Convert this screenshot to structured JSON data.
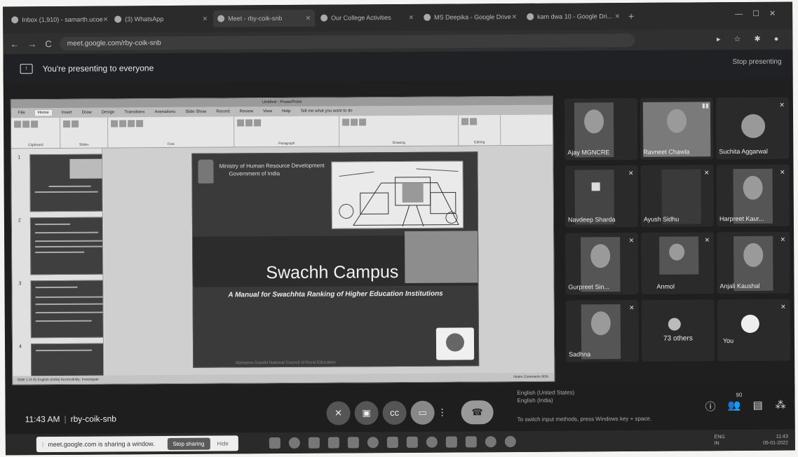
{
  "browser": {
    "tabs": [
      {
        "label": "Inbox (1,910) - samarth.ucoe",
        "active": false
      },
      {
        "label": "(3) WhatsApp",
        "active": false
      },
      {
        "label": "Meet - rby-coik-snb",
        "active": true
      },
      {
        "label": "Our College Activities",
        "active": false
      },
      {
        "label": "MS Deepika - Google Drive",
        "active": false
      },
      {
        "label": "kam dwa 10 - Google Dri...",
        "active": false
      }
    ],
    "url": "meet.google.com/rby-coik-snb"
  },
  "banner": {
    "text": "You're presenting to everyone",
    "stop_label": "Stop presenting"
  },
  "ppt": {
    "title": "Untitled - PowerPoint",
    "menu": [
      "File",
      "Home",
      "Insert",
      "Draw",
      "Design",
      "Transitions",
      "Animations",
      "Slide Show",
      "Record",
      "Review",
      "View",
      "Help",
      "Tell me what you want to do"
    ],
    "groups": [
      "Clipboard",
      "Slides",
      "Font",
      "Paragraph",
      "Drawing",
      "Editing"
    ],
    "thumb_numbers": [
      "1",
      "2",
      "3",
      "4"
    ],
    "status_left": "Slide 1 of 35   English (India)   Accessibility: Investigate",
    "status_right": "Notes   Comments        80%"
  },
  "slide": {
    "ministry": "Ministry of Human Resource Development",
    "government": "Government of India",
    "title": "Swachh Campus",
    "subtitle": "A Manual for Swachhta Ranking of Higher Education Institutions",
    "footer": "Mahatma Gandhi National Council of Rural Education"
  },
  "participants": [
    {
      "name": "Ajay MGNCRE",
      "type": "video"
    },
    {
      "name": "Ravneet Chawla",
      "type": "video"
    },
    {
      "name": "Suchita Aggarwal",
      "type": "avatar"
    },
    {
      "name": "Navdeep Sharda",
      "type": "video"
    },
    {
      "name": "Ayush Sidhu",
      "type": "video"
    },
    {
      "name": "Harpreet Kaur...",
      "type": "video"
    },
    {
      "name": "Gurpreet Sin...",
      "type": "video"
    },
    {
      "name": "Anmol",
      "type": "video"
    },
    {
      "name": "Anjali Kaushal",
      "type": "video"
    },
    {
      "name": "Sadhna",
      "type": "video"
    },
    {
      "name": "73 others",
      "type": "others"
    },
    {
      "name": "You",
      "type": "avatar"
    }
  ],
  "controls": {
    "time": "11:43 AM",
    "separator": "|",
    "meeting_code": "rby-coik-snb",
    "participant_count": "90"
  },
  "ime": {
    "line1": "English (United States)",
    "line2": "English (India)",
    "tip": "To switch input methods, press Windows key + space."
  },
  "taskbar": {
    "share_notice": "meet.google.com is sharing a window.",
    "stop_sharing": "Stop sharing",
    "hide": "Hide",
    "lang": "ENG",
    "lang2": "IN",
    "time": "11:43",
    "date": "05-01-2022"
  }
}
